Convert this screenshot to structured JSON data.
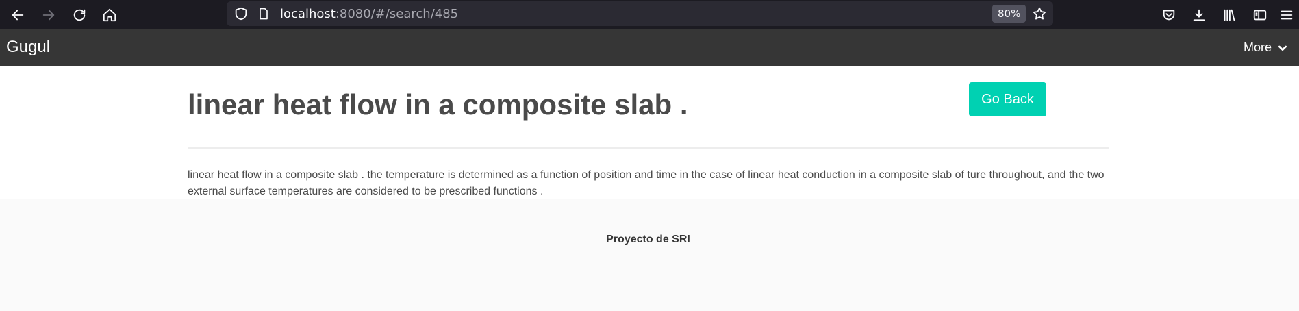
{
  "browser": {
    "url_host": "localhost",
    "url_path": ":8080/#/search/485",
    "zoom": "80%",
    "icons": [
      "back-arrow-icon",
      "forward-arrow-icon",
      "reload-icon",
      "home-icon",
      "shield-icon",
      "page-icon",
      "star-icon",
      "pocket-icon",
      "download-icon",
      "library-icon",
      "sidebar-icon",
      "menu-icon"
    ]
  },
  "navbar": {
    "brand": "Gugul",
    "more_label": "More"
  },
  "document": {
    "title": "linear heat flow in a composite slab .",
    "go_back_label": "Go Back",
    "body": "linear heat flow in a composite slab . the temperature is determined as a function of position and time in the case of linear heat conduction in a composite slab of ture throughout, and the two external surface temperatures are considered to be prescribed functions ."
  },
  "footer": {
    "text": "Proyecto de SRI"
  },
  "colors": {
    "browser_bg": "#1c1b22",
    "urlbar_bg": "#2b2a33",
    "navbar_bg": "#363636",
    "accent": "#00d1b2",
    "footer_bg": "#fafafa"
  }
}
